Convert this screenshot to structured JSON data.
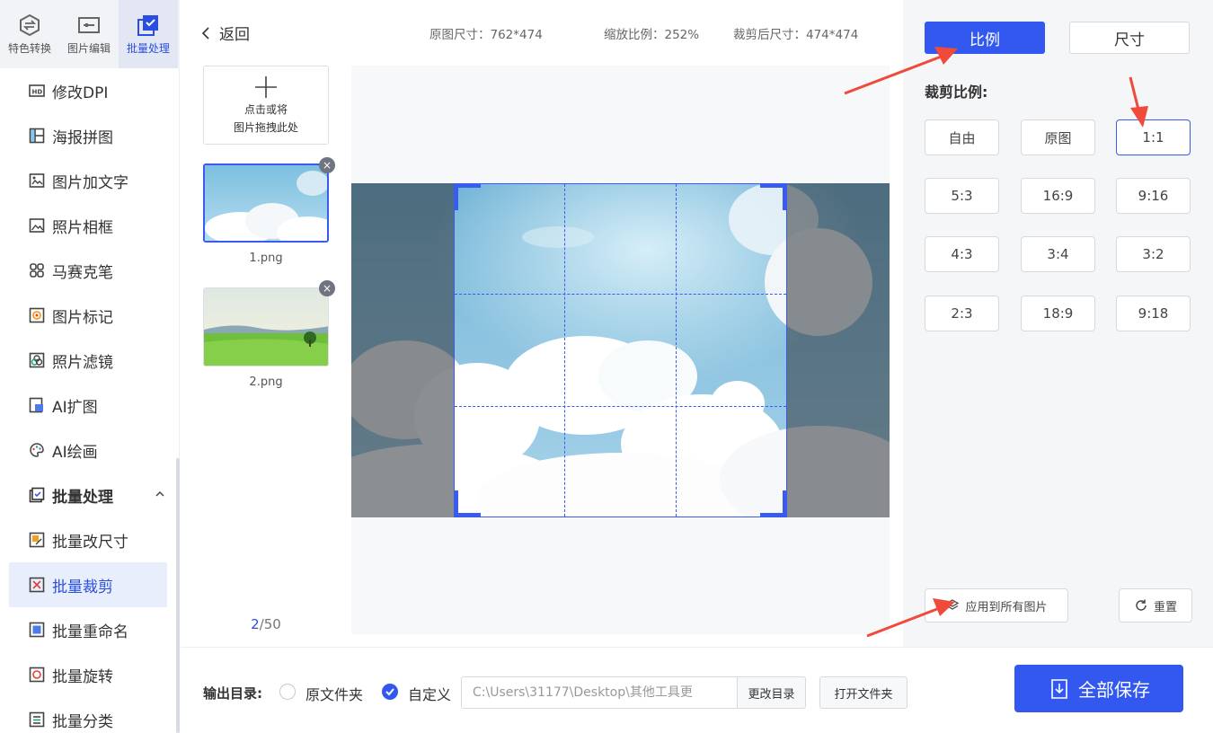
{
  "topnav": [
    {
      "label": "特色转换",
      "icon": "convert-icon"
    },
    {
      "label": "图片编辑",
      "icon": "image-edit-icon"
    },
    {
      "label": "批量处理",
      "icon": "batch-icon"
    }
  ],
  "menu": [
    {
      "label": "修改DPI",
      "icon": "hd-icon"
    },
    {
      "label": "海报拼图",
      "icon": "poster-icon"
    },
    {
      "label": "图片加文字",
      "icon": "text-image-icon"
    },
    {
      "label": "照片相框",
      "icon": "frame-icon"
    },
    {
      "label": "马赛克笔",
      "icon": "mosaic-icon"
    },
    {
      "label": "图片标记",
      "icon": "marker-icon"
    },
    {
      "label": "照片滤镜",
      "icon": "filter-icon"
    },
    {
      "label": "AI扩图",
      "icon": "ai-expand-icon"
    },
    {
      "label": "AI绘画",
      "icon": "ai-paint-icon"
    }
  ],
  "batch_section": {
    "label": "批量处理"
  },
  "batch_menu": [
    {
      "label": "批量改尺寸"
    },
    {
      "label": "批量裁剪"
    },
    {
      "label": "批量重命名"
    },
    {
      "label": "批量旋转"
    },
    {
      "label": "批量分类"
    }
  ],
  "header": {
    "back": "返回",
    "original_size": "原图尺寸：762*474",
    "zoom": "缩放比例：252%",
    "cropped_size": "裁剪后尺寸：474*474"
  },
  "upload": {
    "line1": "点击或将",
    "line2": "图片拖拽此处"
  },
  "thumbs": [
    {
      "name": "1.png"
    },
    {
      "name": "2.png"
    }
  ],
  "pager": {
    "current": "2",
    "total": "/50"
  },
  "right": {
    "tab_ratio": "比例",
    "tab_size": "尺寸",
    "ratio_label": "裁剪比例:",
    "ratios": [
      "自由",
      "原图",
      "1:1",
      "5:3",
      "16:9",
      "9:16",
      "4:3",
      "3:4",
      "3:2",
      "2:3",
      "18:9",
      "9:18"
    ],
    "selected_ratio": "1:1",
    "apply_all": "应用到所有图片",
    "reset": "重置"
  },
  "output": {
    "label": "输出目录:",
    "option_original": "原文件夹",
    "option_custom": "自定义",
    "path": "C:\\Users\\31177\\Desktop\\其他工具更",
    "change_dir": "更改目录",
    "open_folder": "打开文件夹",
    "save_all": "全部保存"
  },
  "colors": {
    "accent": "#3258f0",
    "annotation_arrow": "#f04a3a"
  }
}
